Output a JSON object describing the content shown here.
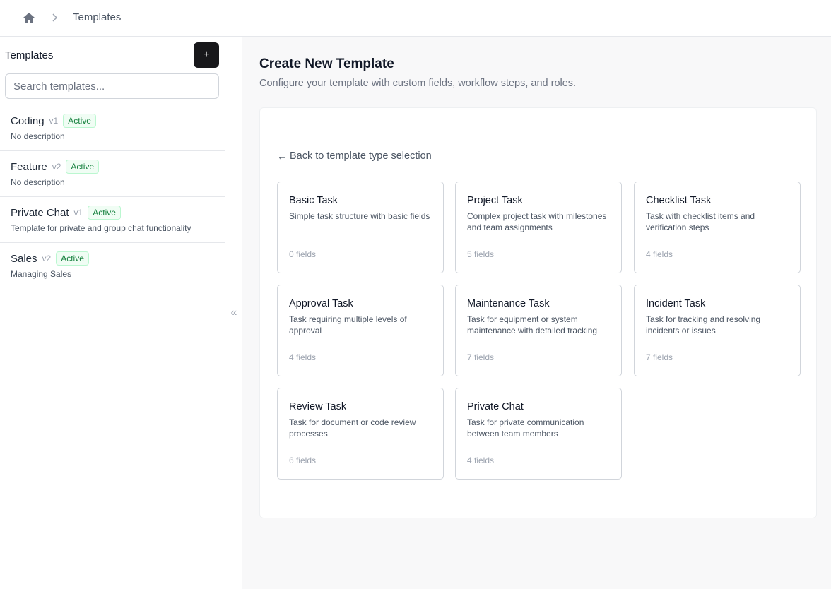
{
  "breadcrumb": {
    "home_icon": "home-icon",
    "separator_icon": "chevron-right-icon",
    "current": "Templates"
  },
  "sidebar": {
    "title": "Templates",
    "add_label": "+",
    "search_placeholder": "Search templates...",
    "items": [
      {
        "name": "Coding",
        "version": "v1",
        "status": "Active",
        "description": "No description"
      },
      {
        "name": "Feature",
        "version": "v2",
        "status": "Active",
        "description": "No description"
      },
      {
        "name": "Private Chat",
        "version": "v1",
        "status": "Active",
        "description": "Template for private and group chat functionality"
      },
      {
        "name": "Sales",
        "version": "v2",
        "status": "Active",
        "description": "Managing Sales"
      }
    ],
    "collapse_label": "«"
  },
  "main": {
    "title": "Create New Template",
    "subtitle": "Configure your template with custom fields, workflow steps, and roles.",
    "back_link": "Back to template type selection",
    "back_arrow": "←",
    "cards": [
      {
        "title": "Basic Task",
        "description": "Simple task structure with basic fields",
        "count": "0 fields"
      },
      {
        "title": "Project Task",
        "description": "Complex project task with milestones and team assignments",
        "count": "5 fields"
      },
      {
        "title": "Checklist Task",
        "description": "Task with checklist items and verification steps",
        "count": "4 fields"
      },
      {
        "title": "Approval Task",
        "description": "Task requiring multiple levels of approval",
        "count": "4 fields"
      },
      {
        "title": "Maintenance Task",
        "description": "Task for equipment or system maintenance with detailed tracking",
        "count": "7 fields"
      },
      {
        "title": "Incident Task",
        "description": "Task for tracking and resolving incidents or issues",
        "count": "7 fields"
      },
      {
        "title": "Review Task",
        "description": "Task for document or code review processes",
        "count": "6 fields"
      },
      {
        "title": "Private Chat",
        "description": "Task for private communication between team members",
        "count": "4 fields"
      }
    ]
  },
  "colors": {
    "badge_text": "#15803d",
    "badge_bg": "#f0fdf4",
    "add_button_bg": "#18181b",
    "main_bg": "#f8f8f9"
  }
}
